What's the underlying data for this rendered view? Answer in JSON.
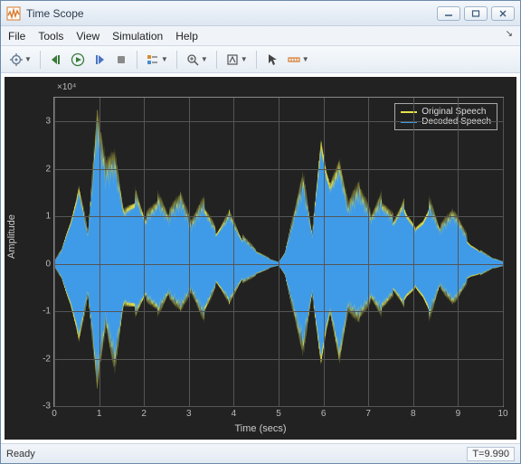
{
  "window": {
    "title": "Time Scope"
  },
  "menu": {
    "file": "File",
    "tools": "Tools",
    "view": "View",
    "simulation": "Simulation",
    "help": "Help"
  },
  "status": {
    "ready": "Ready",
    "time": "T=9.990"
  },
  "chart_data": {
    "type": "line",
    "title": "",
    "xlabel": "Time (secs)",
    "ylabel": "Amplitude",
    "y_exponent_label": "×10⁴",
    "xlim": [
      0,
      10
    ],
    "ylim": [
      -3,
      3.5
    ],
    "xticks": [
      0,
      1,
      2,
      3,
      4,
      5,
      6,
      7,
      8,
      9,
      10
    ],
    "yticks": [
      -3,
      -2,
      -1,
      0,
      1,
      2,
      3
    ],
    "series": [
      {
        "name": "Original Speech",
        "color": "#e6e24a"
      },
      {
        "name": "Decoded Speech",
        "color": "#3f9be8"
      }
    ],
    "envelope_note": "dense speech waveform; values x1e4; envelope peaks approx below",
    "envelope": [
      {
        "t": 0.0,
        "lo": -0.05,
        "hi": 0.05
      },
      {
        "t": 0.15,
        "lo": -0.3,
        "hi": 0.3
      },
      {
        "t": 0.35,
        "lo": -1.1,
        "hi": 1.1
      },
      {
        "t": 0.55,
        "lo": -1.9,
        "hi": 1.9
      },
      {
        "t": 0.75,
        "lo": -0.7,
        "hi": 0.7
      },
      {
        "t": 0.95,
        "lo": -2.6,
        "hi": 3.2
      },
      {
        "t": 1.15,
        "lo": -1.3,
        "hi": 2.1
      },
      {
        "t": 1.35,
        "lo": -2.3,
        "hi": 2.4
      },
      {
        "t": 1.55,
        "lo": -1.0,
        "hi": 1.3
      },
      {
        "t": 1.8,
        "lo": -1.2,
        "hi": 1.7
      },
      {
        "t": 2.05,
        "lo": -0.8,
        "hi": 1.1
      },
      {
        "t": 2.3,
        "lo": -1.1,
        "hi": 1.5
      },
      {
        "t": 2.55,
        "lo": -0.7,
        "hi": 1.1
      },
      {
        "t": 2.8,
        "lo": -1.0,
        "hi": 1.5
      },
      {
        "t": 3.05,
        "lo": -0.6,
        "hi": 0.9
      },
      {
        "t": 3.35,
        "lo": -1.2,
        "hi": 1.4
      },
      {
        "t": 3.6,
        "lo": -0.5,
        "hi": 0.8
      },
      {
        "t": 3.9,
        "lo": -0.9,
        "hi": 1.2
      },
      {
        "t": 4.2,
        "lo": -0.4,
        "hi": 0.6
      },
      {
        "t": 4.5,
        "lo": -0.25,
        "hi": 0.3
      },
      {
        "t": 4.8,
        "lo": -0.1,
        "hi": 0.12
      },
      {
        "t": 5.0,
        "lo": -0.05,
        "hi": 0.05
      },
      {
        "t": 5.15,
        "lo": -0.3,
        "hi": 0.3
      },
      {
        "t": 5.35,
        "lo": -1.1,
        "hi": 1.1
      },
      {
        "t": 5.55,
        "lo": -1.9,
        "hi": 1.9
      },
      {
        "t": 5.75,
        "lo": -0.7,
        "hi": 0.7
      },
      {
        "t": 5.95,
        "lo": -2.6,
        "hi": 3.2
      },
      {
        "t": 6.15,
        "lo": -1.3,
        "hi": 2.1
      },
      {
        "t": 6.35,
        "lo": -2.3,
        "hi": 2.4
      },
      {
        "t": 6.55,
        "lo": -1.0,
        "hi": 1.3
      },
      {
        "t": 6.8,
        "lo": -1.2,
        "hi": 1.7
      },
      {
        "t": 7.05,
        "lo": -0.8,
        "hi": 1.1
      },
      {
        "t": 7.3,
        "lo": -1.1,
        "hi": 1.5
      },
      {
        "t": 7.55,
        "lo": -0.7,
        "hi": 1.1
      },
      {
        "t": 7.8,
        "lo": -1.0,
        "hi": 1.5
      },
      {
        "t": 8.05,
        "lo": -0.6,
        "hi": 0.9
      },
      {
        "t": 8.35,
        "lo": -1.2,
        "hi": 1.4
      },
      {
        "t": 8.6,
        "lo": -0.5,
        "hi": 0.8
      },
      {
        "t": 8.9,
        "lo": -0.9,
        "hi": 1.2
      },
      {
        "t": 9.2,
        "lo": -0.4,
        "hi": 0.6
      },
      {
        "t": 9.5,
        "lo": -0.25,
        "hi": 0.3
      },
      {
        "t": 9.8,
        "lo": -0.1,
        "hi": 0.12
      },
      {
        "t": 10.0,
        "lo": -0.05,
        "hi": 0.05
      }
    ]
  }
}
